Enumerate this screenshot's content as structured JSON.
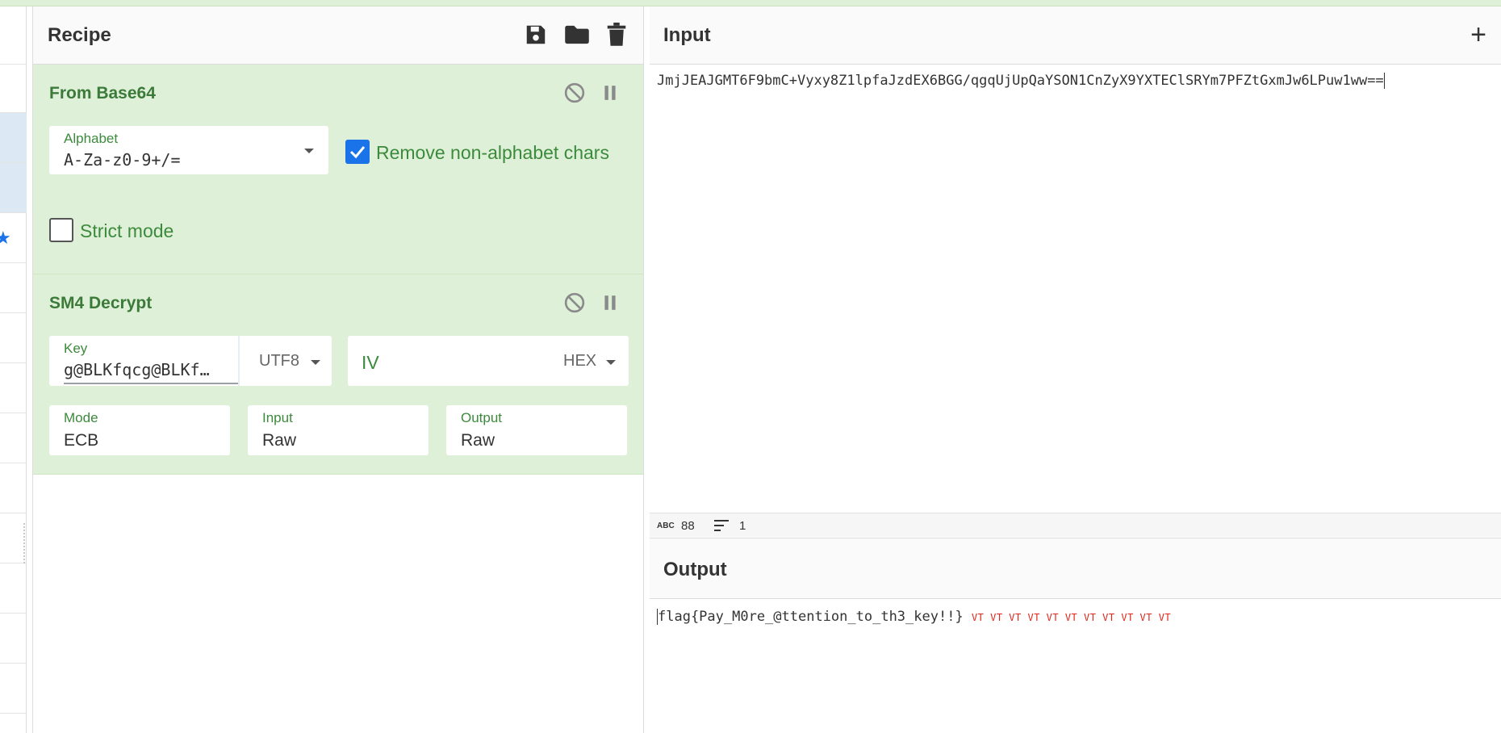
{
  "recipe": {
    "title": "Recipe",
    "icons": [
      "save-icon",
      "folder-icon",
      "trash-icon"
    ],
    "ops": [
      {
        "title": "From Base64",
        "alphabet_label": "Alphabet",
        "alphabet_value": "A-Za-z0-9+/=",
        "remove_label": "Remove non-alphabet chars",
        "remove_checked": true,
        "strict_label": "Strict mode",
        "strict_checked": false
      },
      {
        "title": "SM4 Decrypt",
        "key_label": "Key",
        "key_value": "g@BLKfqcg@BLKf…",
        "key_encoding": "UTF8",
        "iv_placeholder": "IV",
        "iv_encoding": "HEX",
        "mode_label": "Mode",
        "mode_value": "ECB",
        "input_label": "Input",
        "input_value": "Raw",
        "output_label": "Output",
        "output_value": "Raw"
      }
    ]
  },
  "input": {
    "title": "Input",
    "text": "JmjJEAJGMT6F9bmC+Vyxy8Z1lpfaJzdEX6BGG/qgqUjUpQaYSON1CnZyX9YXTEClSRYm7PFZtGxmJw6LPuw1ww==",
    "char_count": "88",
    "line_count": "1"
  },
  "output": {
    "title": "Output",
    "text": "flag{Pay_M0re_@ttention_to_th3_key!!}",
    "control_chars": "VT VT VT VT VT VT VT VT VT VT VT"
  },
  "colors": {
    "accent": "#1a73e8",
    "op_bg": "#dff0d8",
    "op_title": "#3c7a3a",
    "control_char": "#e0261b"
  }
}
